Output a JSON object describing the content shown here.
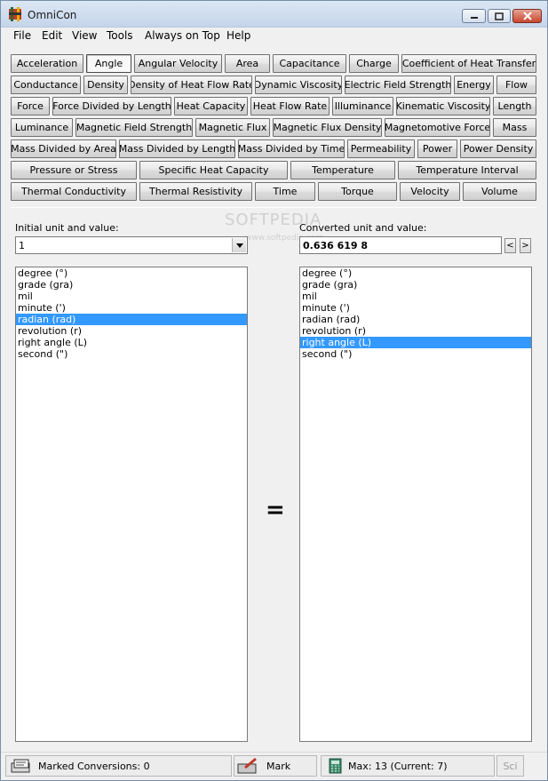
{
  "window": {
    "title": "OmniCon"
  },
  "menu": [
    "File",
    "Edit",
    "View",
    "Tools",
    "Always on Top",
    "Help"
  ],
  "quantities": {
    "selected": "Angle",
    "rows": [
      [
        "Acceleration",
        "Angle",
        "Angular Velocity",
        "Area",
        "Capacitance",
        "Charge",
        "Coefficient of Heat Transfer"
      ],
      [
        "Conductance",
        "Density",
        "Density of Heat Flow Rate",
        "Dynamic Viscosity",
        "Electric Field Strength",
        "Energy",
        "Flow"
      ],
      [
        "Force",
        "Force Divided by Length",
        "Heat Capacity",
        "Heat Flow Rate",
        "Illuminance",
        "Kinematic Viscosity",
        "Length"
      ],
      [
        "Luminance",
        "Magnetic Field Strength",
        "Magnetic Flux",
        "Magnetic Flux Density",
        "Magnetomotive Force",
        "Mass"
      ],
      [
        "Mass Divided by Area",
        "Mass Divided by Length",
        "Mass Divided by Time",
        "Permeability",
        "Power",
        "Power Density"
      ],
      [
        "Pressure or Stress",
        "Specific Heat Capacity",
        "Temperature",
        "Temperature Interval"
      ],
      [
        "Thermal Conductivity",
        "Thermal Resistivity",
        "Time",
        "Torque",
        "Velocity",
        "Volume"
      ]
    ]
  },
  "initial": {
    "label": "Initial unit and value:",
    "value": "1",
    "units": [
      "degree (°)",
      "grade (gra)",
      "mil",
      "minute (')",
      "radian (rad)",
      "revolution (r)",
      "right angle (L)",
      "second (\")"
    ],
    "selected_index": 4
  },
  "converted": {
    "label": "Converted unit and value:",
    "value": "0.636 619 8",
    "units": [
      "degree (°)",
      "grade (gra)",
      "mil",
      "minute (')",
      "radian (rad)",
      "revolution (r)",
      "right angle (L)",
      "second (\")"
    ],
    "selected_index": 6
  },
  "equals_sign": "=",
  "spin": {
    "left": "<",
    "right": ">"
  },
  "watermark": {
    "main": "SOFTPEDIA",
    "sub": "www.softpedia.com"
  },
  "status": {
    "marked": "Marked Conversions: 0",
    "mark_button": "Mark",
    "max": "Max: 13 (Current: 7)",
    "sci": "Sci"
  },
  "colors": {
    "selection": "#3399ff",
    "close_button": "#c8462f"
  }
}
